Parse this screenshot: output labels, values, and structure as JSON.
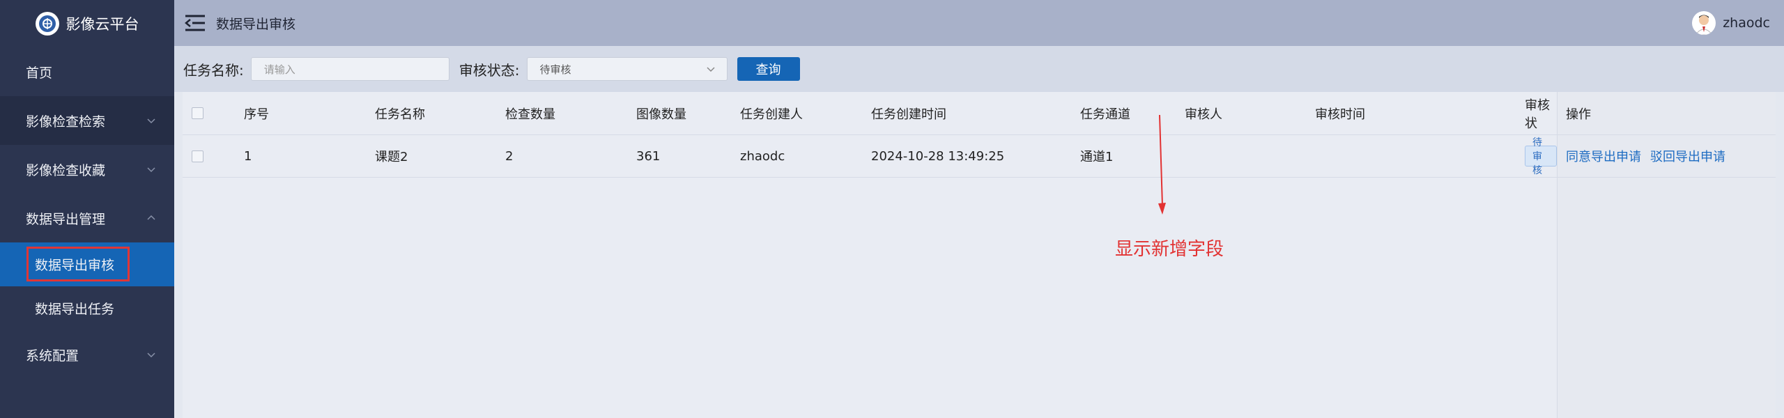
{
  "app": {
    "title": "影像云平台"
  },
  "sidebar": {
    "items": [
      {
        "label": "首页"
      },
      {
        "label": "影像检查检索"
      },
      {
        "label": "影像检查收藏"
      },
      {
        "label": "数据导出管理"
      }
    ],
    "sub_items": [
      {
        "label": "数据导出审核"
      },
      {
        "label": "数据导出任务"
      }
    ],
    "system": {
      "label": "系统配置"
    }
  },
  "header": {
    "title": "数据导出审核",
    "username": "zhaodc"
  },
  "filters": {
    "task_name_label": "任务名称:",
    "task_name_placeholder": "请输入",
    "status_label": "审核状态:",
    "status_value": "待审核",
    "query_button": "查询"
  },
  "table": {
    "columns": [
      "序号",
      "任务名称",
      "检查数量",
      "图像数量",
      "任务创建人",
      "任务创建时间",
      "任务通道",
      "审核人",
      "审核时间",
      "审核状",
      "操作"
    ],
    "rows": [
      {
        "index": "1",
        "task_name": "课题2",
        "exam_count": "2",
        "image_count": "361",
        "creator": "zhaodc",
        "created_at": "2024-10-28 13:49:25",
        "channel": "通道1",
        "reviewer": "",
        "review_time": "",
        "status": "待审核",
        "actions": [
          "同意导出申请",
          "驳回导出申请"
        ]
      }
    ]
  },
  "annotation": {
    "text": "显示新增字段"
  },
  "colors": {
    "sidebar": "#2c3550",
    "accent": "#1565b5",
    "annotation": "#e23232"
  }
}
